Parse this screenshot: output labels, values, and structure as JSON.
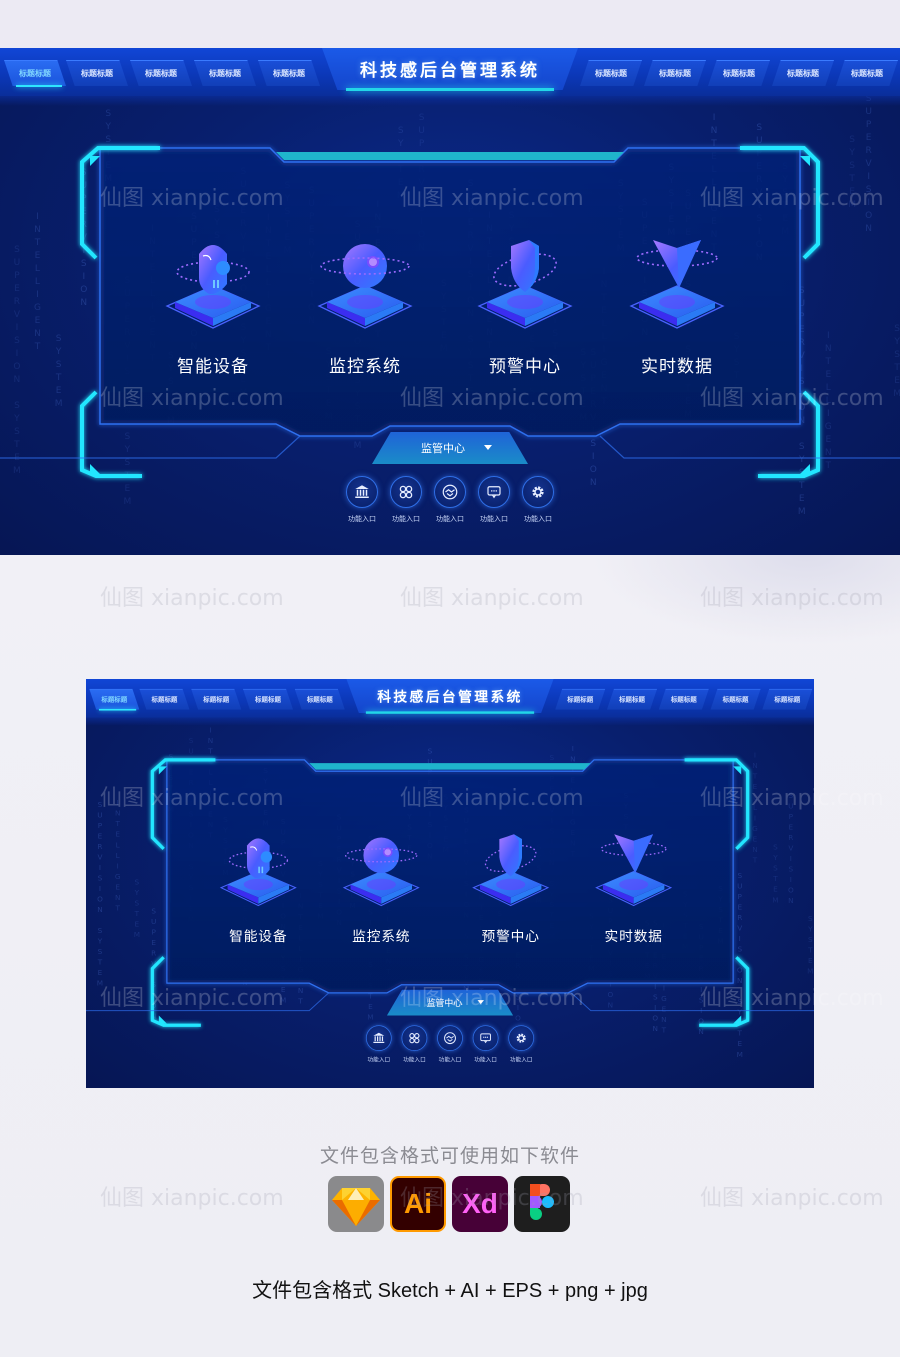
{
  "dashboard": {
    "title": "科技感后台管理系统",
    "tabs_left": [
      "标题标题",
      "标题标题",
      "标题标题",
      "标题标题",
      "标题标题"
    ],
    "tabs_right": [
      "标题标题",
      "标题标题",
      "标题标题",
      "标题标题",
      "标题标题"
    ],
    "active_tab_index": 0,
    "modules": [
      {
        "label": "智能设备",
        "icon": "robot-head-icon"
      },
      {
        "label": "监控系统",
        "icon": "camera-sphere-icon"
      },
      {
        "label": "预警中心",
        "icon": "shield-icon"
      },
      {
        "label": "实时数据",
        "icon": "data-cone-icon"
      }
    ],
    "dropdown": {
      "label": "监管中心",
      "icon": "caret-down-icon"
    },
    "entries": [
      {
        "label": "功能入口",
        "icon": "bank-icon"
      },
      {
        "label": "功能入口",
        "icon": "command-icon"
      },
      {
        "label": "功能入口",
        "icon": "handshake-icon"
      },
      {
        "label": "功能入口",
        "icon": "message-icon"
      },
      {
        "label": "功能入口",
        "icon": "gear-icon"
      }
    ],
    "matrix_words": [
      "SUPERVISION SYSTEM",
      "INTELLIGENT",
      "SYSTEM",
      "SUPERVISION",
      "SYSTEM"
    ]
  },
  "watermark": "仙图 xianpic.com",
  "info": {
    "heading": "文件包含格式可使用如下软件",
    "apps": [
      {
        "name": "Sketch",
        "icon": "sketch-icon",
        "text": ""
      },
      {
        "name": "Illustrator",
        "icon": "illustrator-icon",
        "text": "Ai"
      },
      {
        "name": "XD",
        "icon": "xd-icon",
        "text": "Xd"
      },
      {
        "name": "Figma",
        "icon": "figma-icon",
        "text": ""
      }
    ],
    "formats": "文件包含格式 Sketch + AI + EPS + png + jpg"
  },
  "colors": {
    "accent_cyan": "#22e6ff",
    "panel_blue": "#081f6e",
    "bar_blue": "#1146d6"
  }
}
